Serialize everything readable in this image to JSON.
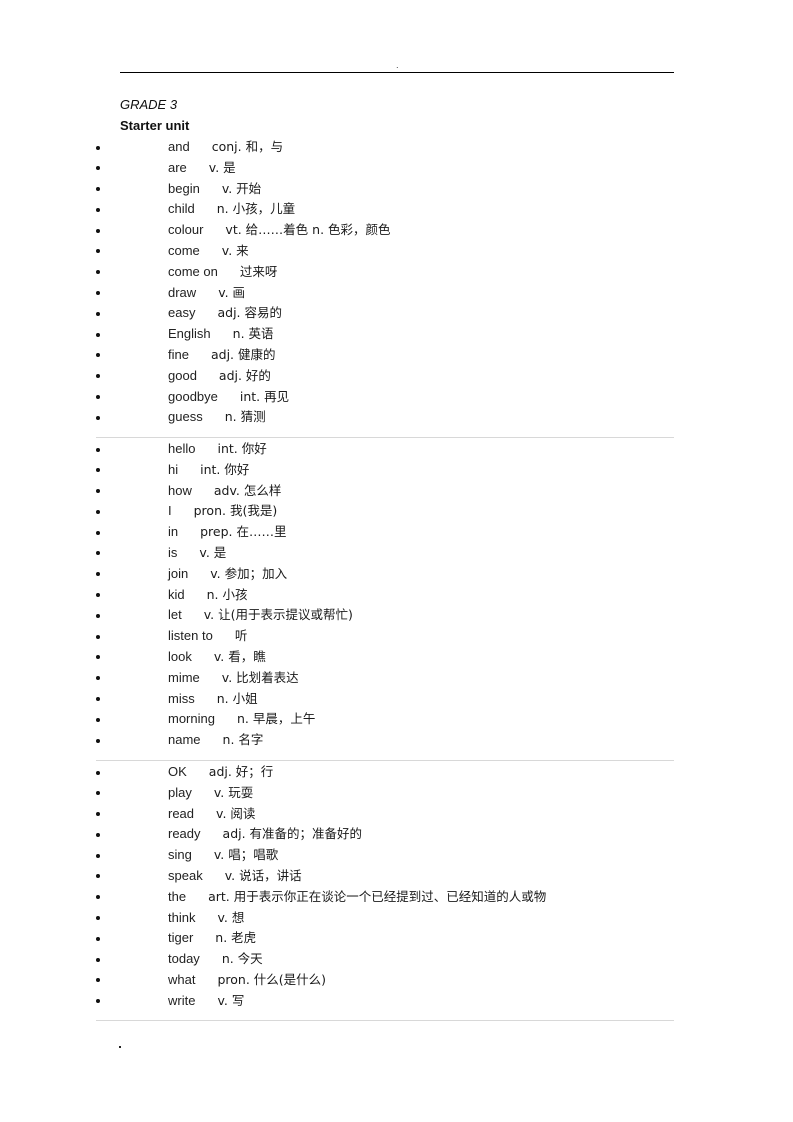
{
  "header": {
    "mark": "."
  },
  "title": "GRADE 3",
  "unit": "Starter unit",
  "groups": [
    [
      {
        "word": "and",
        "def": "conj.  和，与"
      },
      {
        "word": "are",
        "def": "v.  是"
      },
      {
        "word": "begin",
        "def": "v.  开始"
      },
      {
        "word": "child",
        "def": "n.  小孩，儿童"
      },
      {
        "word": "colour",
        "def": "vt.  给……着色    n.  色彩，颜色"
      },
      {
        "word": "come",
        "def": "v.  来"
      },
      {
        "word": "come on",
        "def": "过来呀"
      },
      {
        "word": "draw",
        "def": "v.  画"
      },
      {
        "word": "easy",
        "def": "adj.  容易的"
      },
      {
        "word": "English",
        "def": "n.  英语"
      },
      {
        "word": "fine",
        "def": "adj.  健康的"
      },
      {
        "word": "good",
        "def": "adj.  好的"
      },
      {
        "word": "goodbye",
        "def": "int.  再见"
      },
      {
        "word": "guess",
        "def": "n.  猜测"
      }
    ],
    [
      {
        "word": "hello",
        "def": "int.  你好"
      },
      {
        "word": "hi",
        "def": "int.  你好"
      },
      {
        "word": "how",
        "def": "adv.  怎么样"
      },
      {
        "word": "I",
        "def": "pron.  我(我是)"
      },
      {
        "word": "in",
        "def": "prep.  在……里"
      },
      {
        "word": "is",
        "def": "v.  是"
      },
      {
        "word": "join",
        "def": "v.  参加；加入"
      },
      {
        "word": "kid",
        "def": "n.  小孩"
      },
      {
        "word": "let",
        "def": "v.  让(用于表示提议或帮忙)"
      },
      {
        "word": "listen to",
        "def": "听"
      },
      {
        "word": "look",
        "def": "v.  看，瞧"
      },
      {
        "word": "mime",
        "def": "v.  比划着表达"
      },
      {
        "word": "miss",
        "def": "n.  小姐"
      },
      {
        "word": "morning",
        "def": "n.  早晨，上午"
      },
      {
        "word": "name",
        "def": "n.  名字"
      }
    ],
    [
      {
        "word": "OK",
        "def": "adj.  好；行"
      },
      {
        "word": "play",
        "def": "v.  玩耍"
      },
      {
        "word": "read",
        "def": "v.  阅读"
      },
      {
        "word": "ready",
        "def": "adj.  有准备的；准备好的"
      },
      {
        "word": "sing",
        "def": "v.  唱；唱歌"
      },
      {
        "word": "speak",
        "def": "v.  说话，讲话"
      },
      {
        "word": "the",
        "def": "art.  用于表示你正在谈论一个已经提到过、已经知道的人或物"
      },
      {
        "word": "think",
        "def": "v.  想"
      },
      {
        "word": "tiger",
        "def": "n.  老虎"
      },
      {
        "word": "today",
        "def": "n.  今天"
      },
      {
        "word": "what",
        "def": "pron.  什么(是什么)"
      },
      {
        "word": "write",
        "def": "v.  写"
      }
    ]
  ]
}
